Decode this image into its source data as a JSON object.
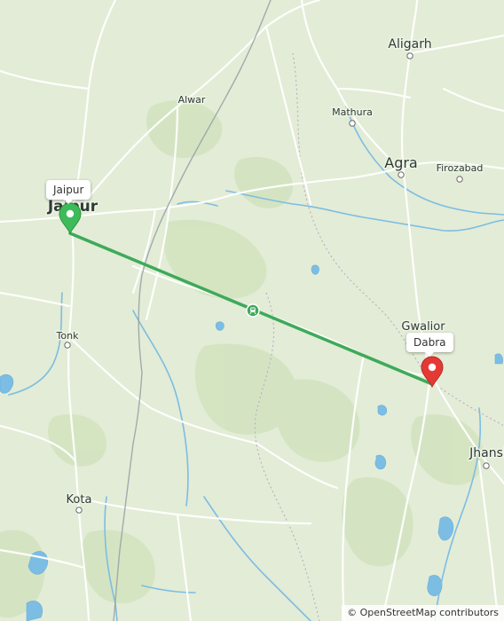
{
  "map": {
    "places": [
      {
        "name": "Aligarh"
      },
      {
        "name": "Alwar"
      },
      {
        "name": "Mathura"
      },
      {
        "name": "Agra"
      },
      {
        "name": "Firozabad"
      },
      {
        "name": "Jaipur"
      },
      {
        "name": "Tonk"
      },
      {
        "name": "Gwalior"
      },
      {
        "name": "Jhansi"
      },
      {
        "name": "Kota"
      }
    ],
    "route": {
      "start": "Jaipur",
      "end": "Dabra",
      "mode_icon": "train-icon",
      "color": "#3daa5a"
    },
    "markers": {
      "start": {
        "label": "Jaipur",
        "color": "#3dbb5a"
      },
      "end": {
        "label": "Dabra",
        "color": "#e53935"
      }
    },
    "colors": {
      "land": "#e3ecd6",
      "forest": "#d2e3bf",
      "water": "#6fb8e0",
      "road": "#ffffff"
    }
  },
  "attribution": {
    "symbol": "©",
    "text": "OpenStreetMap contributors"
  }
}
